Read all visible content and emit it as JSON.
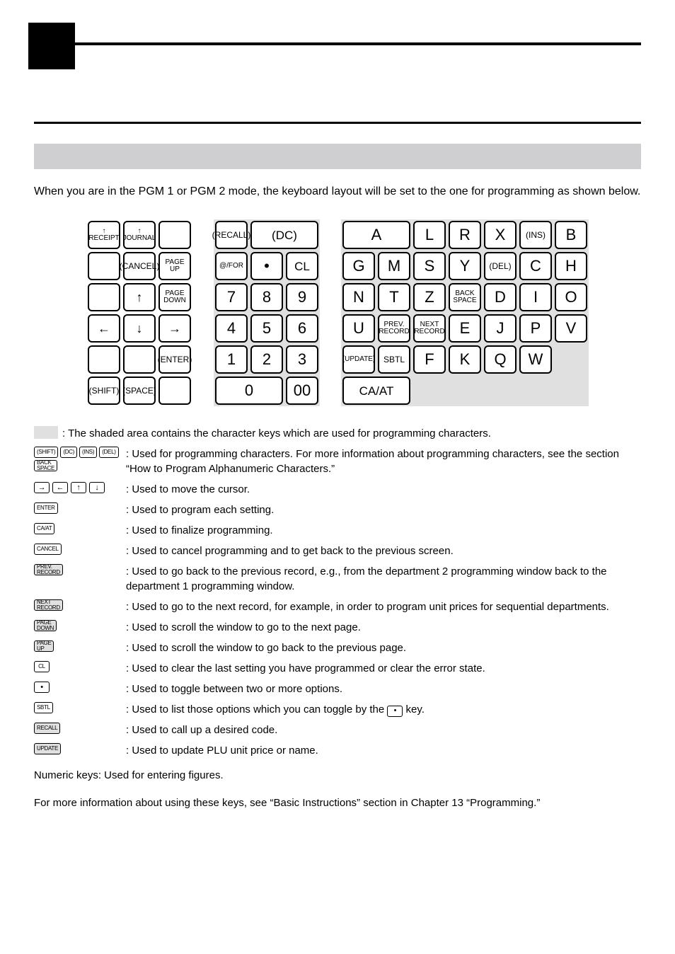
{
  "intro": "When you are in the PGM 1 or PGM 2 mode, the keyboard layout will be set to the one for programming as shown below.",
  "kbd_left": {
    "r0": [
      "↑\nRECEIPT",
      "↑\nJOURNAL",
      ""
    ],
    "r1": [
      "",
      "(CANCEL)",
      "PAGE\nUP"
    ],
    "r2": [
      "",
      "↑",
      "PAGE\nDOWN"
    ],
    "r3": [
      "←",
      "↓",
      "→"
    ],
    "r4": [
      "",
      "",
      "(ENTER)"
    ],
    "r5": [
      "(SHIFT)",
      "(SPACE)",
      ""
    ]
  },
  "kbd_mid": {
    "r0": {
      "recall": "(RECALL)",
      "dc": "(DC)"
    },
    "r1": {
      "for": "@/FOR",
      "dot": "•",
      "cl": "CL"
    },
    "r2": [
      "7",
      "8",
      "9"
    ],
    "r3": [
      "4",
      "5",
      "6"
    ],
    "r4": [
      "1",
      "2",
      "3"
    ],
    "r5": {
      "zero": "0",
      "dzero": "00"
    }
  },
  "kbd_alpha": {
    "r0": [
      "A",
      "",
      "L",
      "R",
      "X",
      "(INS)"
    ],
    "r1": [
      "B",
      "G",
      "M",
      "S",
      "Y",
      "(DEL)"
    ],
    "r2": [
      "C",
      "H",
      "N",
      "T",
      "Z",
      "BACK\nSPACE"
    ],
    "r3": [
      "D",
      "I",
      "O",
      "U",
      "PREV.\nRECORD",
      "NEXT\nRECORD"
    ],
    "r4": [
      "E",
      "J",
      "P",
      "V",
      "(UPDATE)",
      "SBTL"
    ],
    "r5": [
      "F",
      "K",
      "Q",
      "W",
      "CA/AT"
    ]
  },
  "shaded_note": ":  The shaded area contains the character keys which are used for programming characters.",
  "charprog": {
    "badges": [
      "(SHIFT)",
      "(DC)",
      "(INS)",
      "(DEL)",
      "BACK\nSPACE"
    ],
    "desc": ":   Used for programming characters. For more information about programming characters, see the section “How to Program Alphanumeric Characters.”"
  },
  "rows": [
    {
      "badges": [
        {
          "t": "→",
          "a": true
        },
        {
          "t": "←",
          "a": true
        },
        {
          "t": "↑",
          "a": true
        },
        {
          "t": "↓",
          "a": true
        }
      ],
      "desc": ":  Used to move the cursor."
    },
    {
      "badges": [
        {
          "t": "ENTER"
        }
      ],
      "desc": ":  Used to program each setting."
    },
    {
      "badges": [
        {
          "t": "CA/AT"
        }
      ],
      "desc": ":  Used to finalize programming."
    },
    {
      "badges": [
        {
          "t": "CANCEL"
        }
      ],
      "desc": ":  Used to cancel programming and to get back to the previous screen."
    },
    {
      "badges": [
        {
          "t": "PREV.\nRECORD",
          "s": true
        }
      ],
      "desc": ":  Used to go back to the previous record, e.g., from the department 2 programming window back to the department 1 programming window."
    },
    {
      "badges": [
        {
          "t": "NEXT\nRECORD",
          "s": true
        }
      ],
      "desc": ":  Used to go to the next record, for example, in order to program unit prices for sequential departments."
    },
    {
      "badges": [
        {
          "t": "PAGE\nDOWN",
          "s": true
        }
      ],
      "desc": ":  Used to scroll the window to go to the next page."
    },
    {
      "badges": [
        {
          "t": "PAGE\nUP",
          "s": true
        }
      ],
      "desc": ":  Used to scroll the window to go back to the previous page."
    },
    {
      "badges": [
        {
          "t": "CL"
        }
      ],
      "desc": ":  Used to clear the last setting you have programmed or clear the error state."
    },
    {
      "badges": [
        {
          "t": "•",
          "a": true
        }
      ],
      "desc": ":  Used to toggle between two or more options."
    },
    {
      "badges": [
        {
          "t": "SBTL"
        }
      ],
      "desc_pre": ":  Used to list those options which you can toggle by the ",
      "inline_badge": "•",
      "desc_post": " key."
    },
    {
      "badges": [
        {
          "t": "RECALL",
          "s": true
        }
      ],
      "desc": ":  Used to call up a desired code."
    },
    {
      "badges": [
        {
          "t": "UPDATE",
          "s": true
        }
      ],
      "desc": ":  Used to update PLU unit price or name."
    }
  ],
  "numeric_note": "Numeric keys: Used for entering figures.",
  "more_info": "For more information about using these keys, see “Basic Instructions” section in Chapter 13 “Programming.”"
}
